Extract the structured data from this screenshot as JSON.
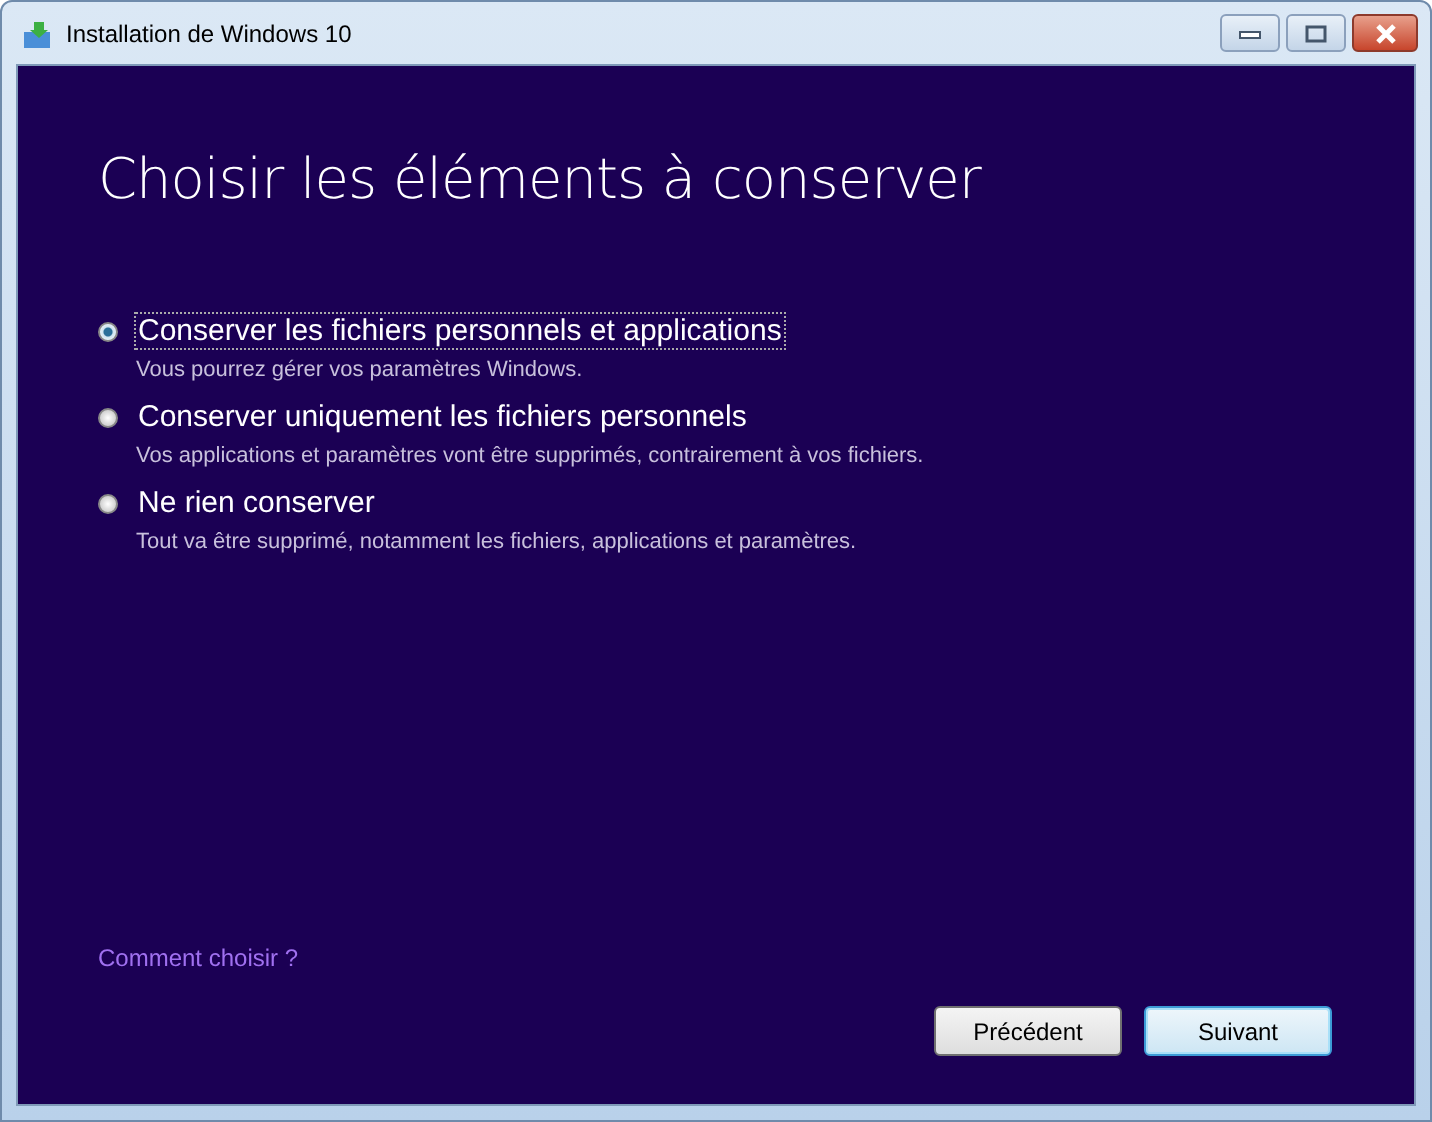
{
  "window": {
    "title": "Installation de Windows 10"
  },
  "heading": "Choisir les éléments à conserver",
  "options": [
    {
      "label": "Conserver les fichiers personnels et applications",
      "description": "Vous pourrez gérer vos paramètres Windows.",
      "selected": true
    },
    {
      "label": "Conserver uniquement les fichiers personnels",
      "description": "Vos applications et paramètres vont être supprimés, contrairement à vos fichiers.",
      "selected": false
    },
    {
      "label": "Ne rien conserver",
      "description": "Tout va être supprimé, notamment les fichiers, applications et paramètres.",
      "selected": false
    }
  ],
  "help_link": "Comment choisir ?",
  "buttons": [
    {
      "label": "Précédent",
      "default": false
    },
    {
      "label": "Suivant",
      "default": true
    }
  ]
}
